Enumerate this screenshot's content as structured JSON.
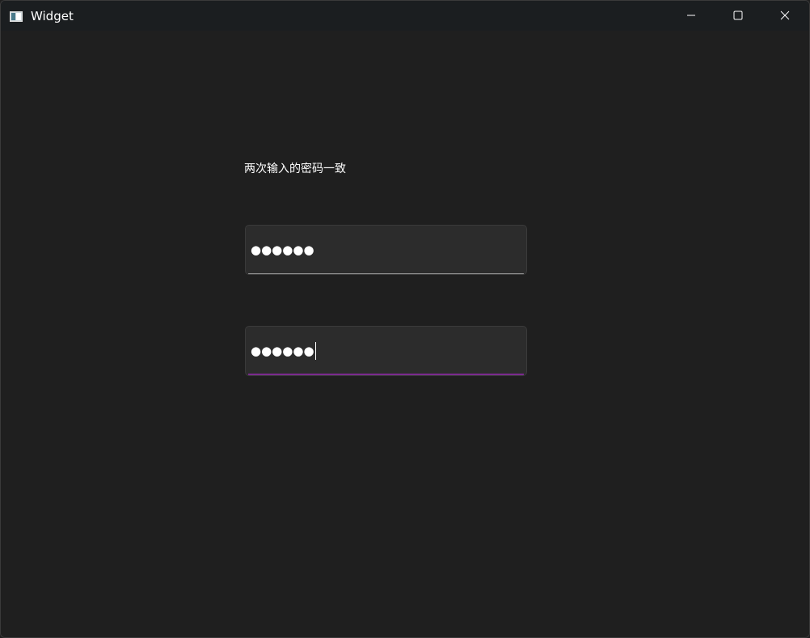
{
  "window": {
    "title": "Widget",
    "app_icon": "window-app-icon"
  },
  "titlebar_buttons": {
    "minimize_icon": "minimize-icon",
    "maximize_icon": "maximize-icon",
    "close_icon": "close-icon"
  },
  "form": {
    "message": "两次输入的密码一致",
    "password1": {
      "masked_value": "●●●●●●",
      "focused": false
    },
    "password2": {
      "masked_value": "●●●●●●",
      "focused": true
    }
  },
  "colors": {
    "background": "#1f1f1f",
    "titlebar": "#1b1e20",
    "input_bg": "#2c2c2c",
    "focus_accent": "#7b2a8f",
    "text": "#ffffff"
  }
}
